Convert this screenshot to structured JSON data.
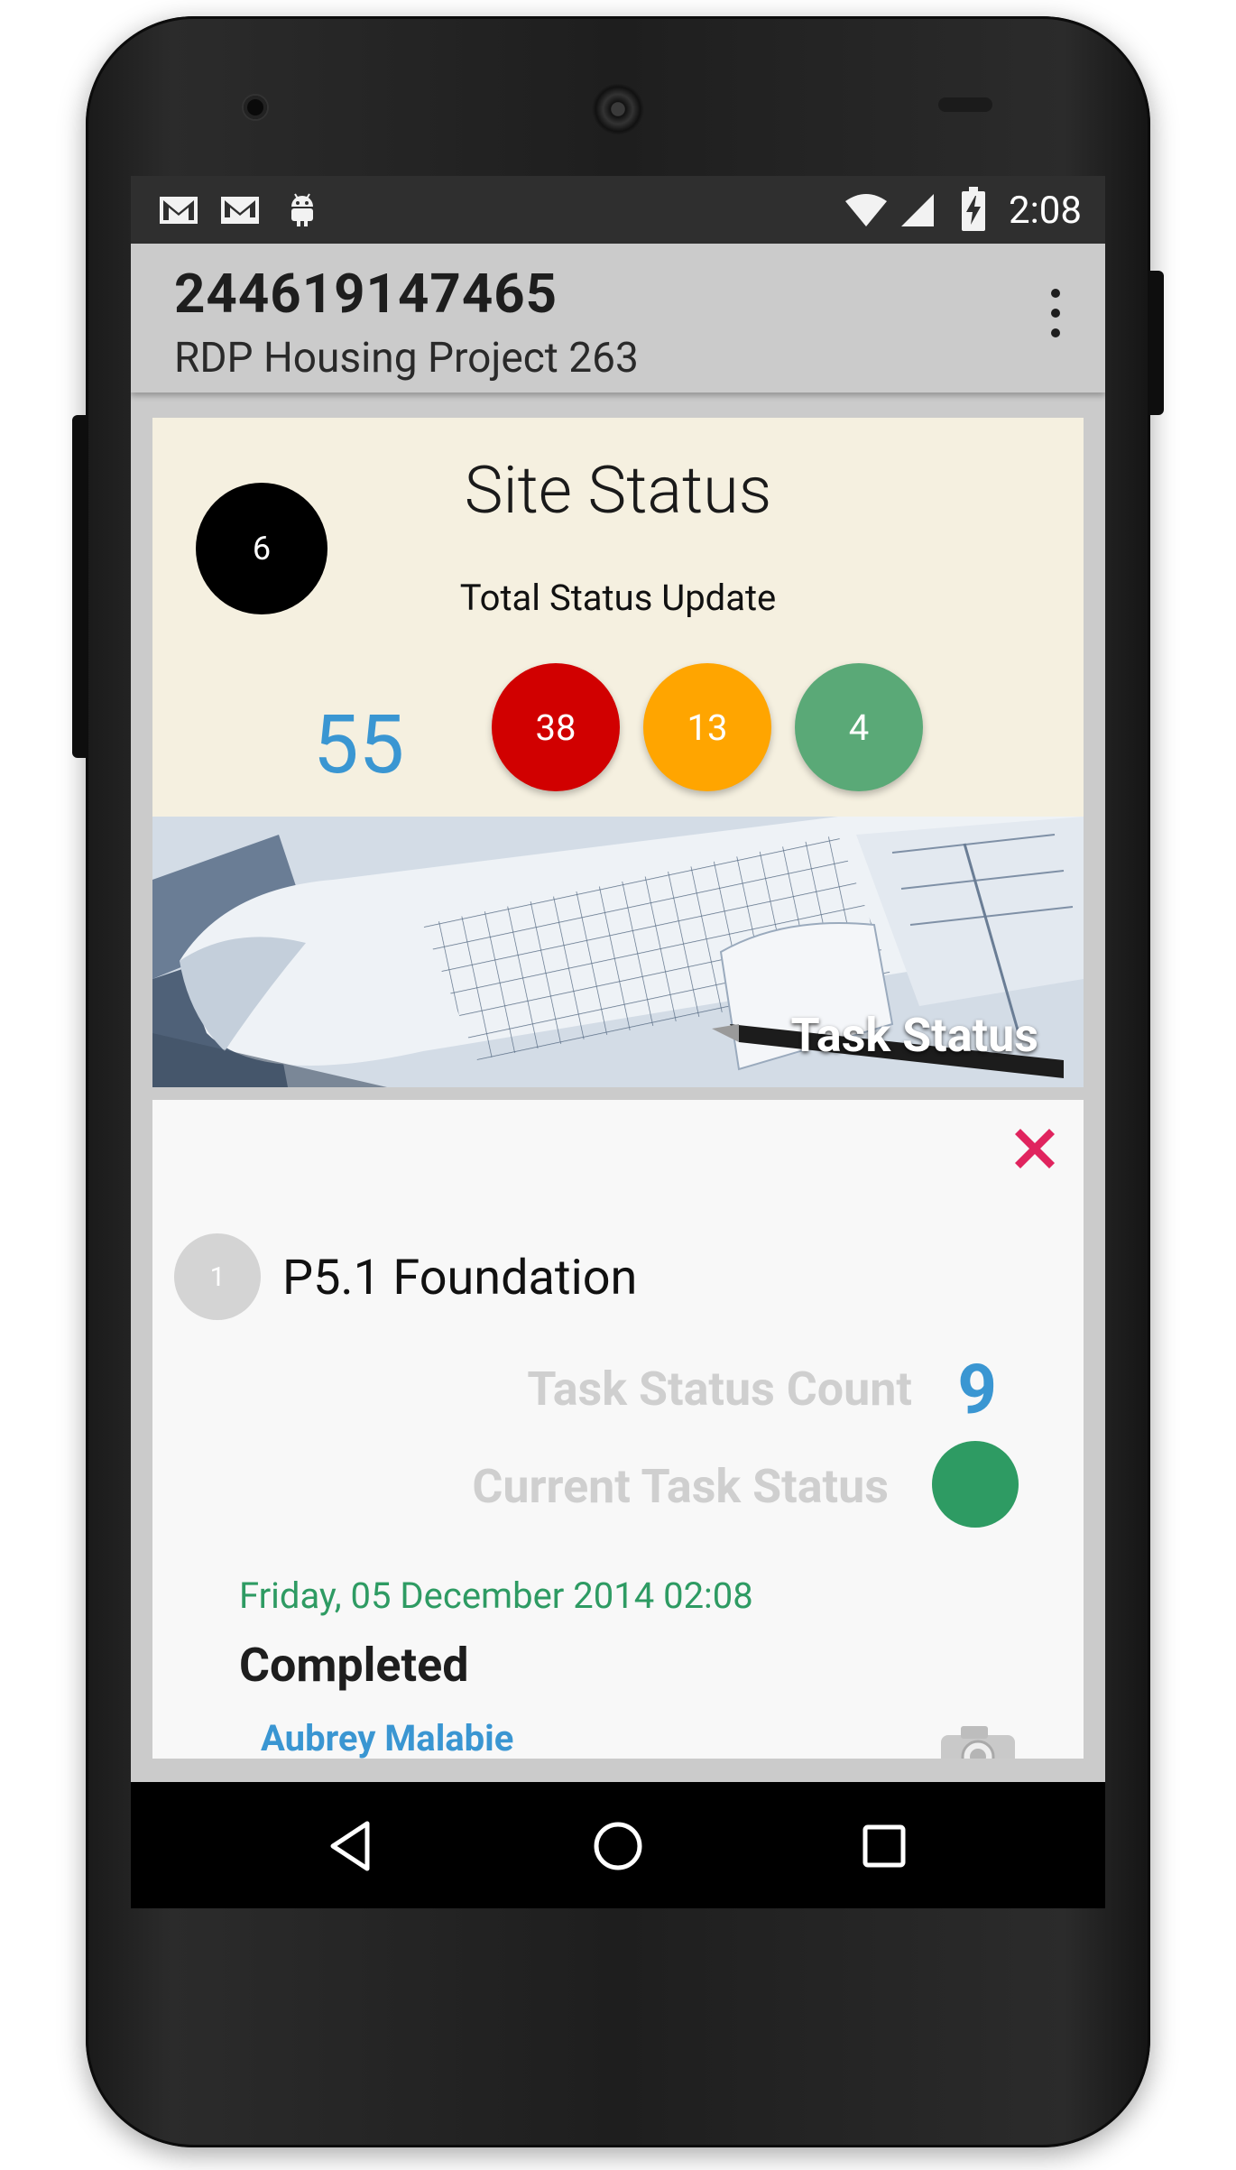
{
  "status_bar": {
    "time": "2:08",
    "left_icons": [
      "gmail-icon",
      "gmail-alt-icon",
      "android-icon"
    ],
    "right_icons": [
      "wifi-icon",
      "signal-icon",
      "battery-charging-icon"
    ]
  },
  "action_bar": {
    "title": "244619147465",
    "subtitle": "RDP Housing Project 263"
  },
  "site_status": {
    "title": "Site Status",
    "site_count": "6",
    "subtitle": "Total Status Update",
    "total": "55",
    "counts": [
      {
        "value": "38",
        "color": "#d10000"
      },
      {
        "value": "13",
        "color": "#ffa500"
      },
      {
        "value": "4",
        "color": "#5aa977"
      }
    ]
  },
  "banner": {
    "title": "Task Status"
  },
  "task": {
    "step_number": "1",
    "name": "P5.1 Foundation",
    "count_label": "Task Status Count",
    "count_value": "9",
    "current_label": "Current Task Status",
    "current_color": "#2e9b63",
    "update": {
      "date": "Friday, 05 December 2014 02:08",
      "status": "Completed",
      "user": "Aubrey Malabie"
    }
  },
  "colors": {
    "accent_blue": "#3a96d2",
    "close_red": "#e0245e",
    "card_beige": "#f5f0e0"
  }
}
